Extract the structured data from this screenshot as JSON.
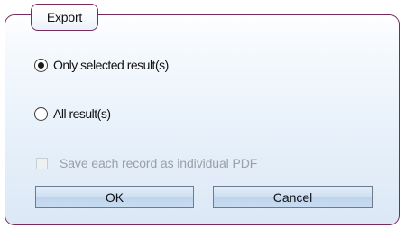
{
  "dialog": {
    "title": "Export",
    "options": [
      {
        "label": "Only selected result(s)",
        "selected": true
      },
      {
        "label": "All result(s)",
        "selected": false
      }
    ],
    "save_individual_pdf": {
      "label": "Save each record as individual PDF",
      "checked": false,
      "enabled": false
    },
    "buttons": {
      "ok_label": "OK",
      "cancel_label": "Cancel"
    }
  },
  "colors": {
    "border": "#7a2a5c",
    "background_top": "#fdfeff",
    "background_bottom": "#dce8f6",
    "button_fill": "#c8dcf1",
    "disabled_text": "#9aa0a6"
  }
}
